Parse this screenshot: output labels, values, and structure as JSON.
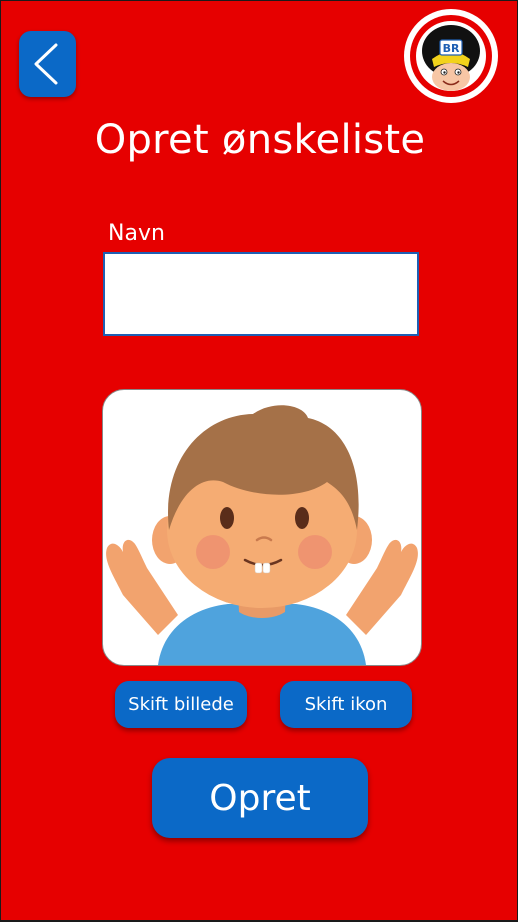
{
  "header": {
    "back_icon": "chevron-left-icon",
    "logo_text": "BR"
  },
  "page": {
    "title": "Opret ønskeliste"
  },
  "form": {
    "name_label": "Navn",
    "name_value": "",
    "name_placeholder": ""
  },
  "avatar": {
    "description_icon": "boy-avatar-icon"
  },
  "buttons": {
    "change_image": "Skift billede",
    "change_icon": "Skift ikon",
    "create": "Opret"
  },
  "colors": {
    "background": "#e60000",
    "button": "#0b69c7",
    "input_border": "#1f5fb3"
  }
}
